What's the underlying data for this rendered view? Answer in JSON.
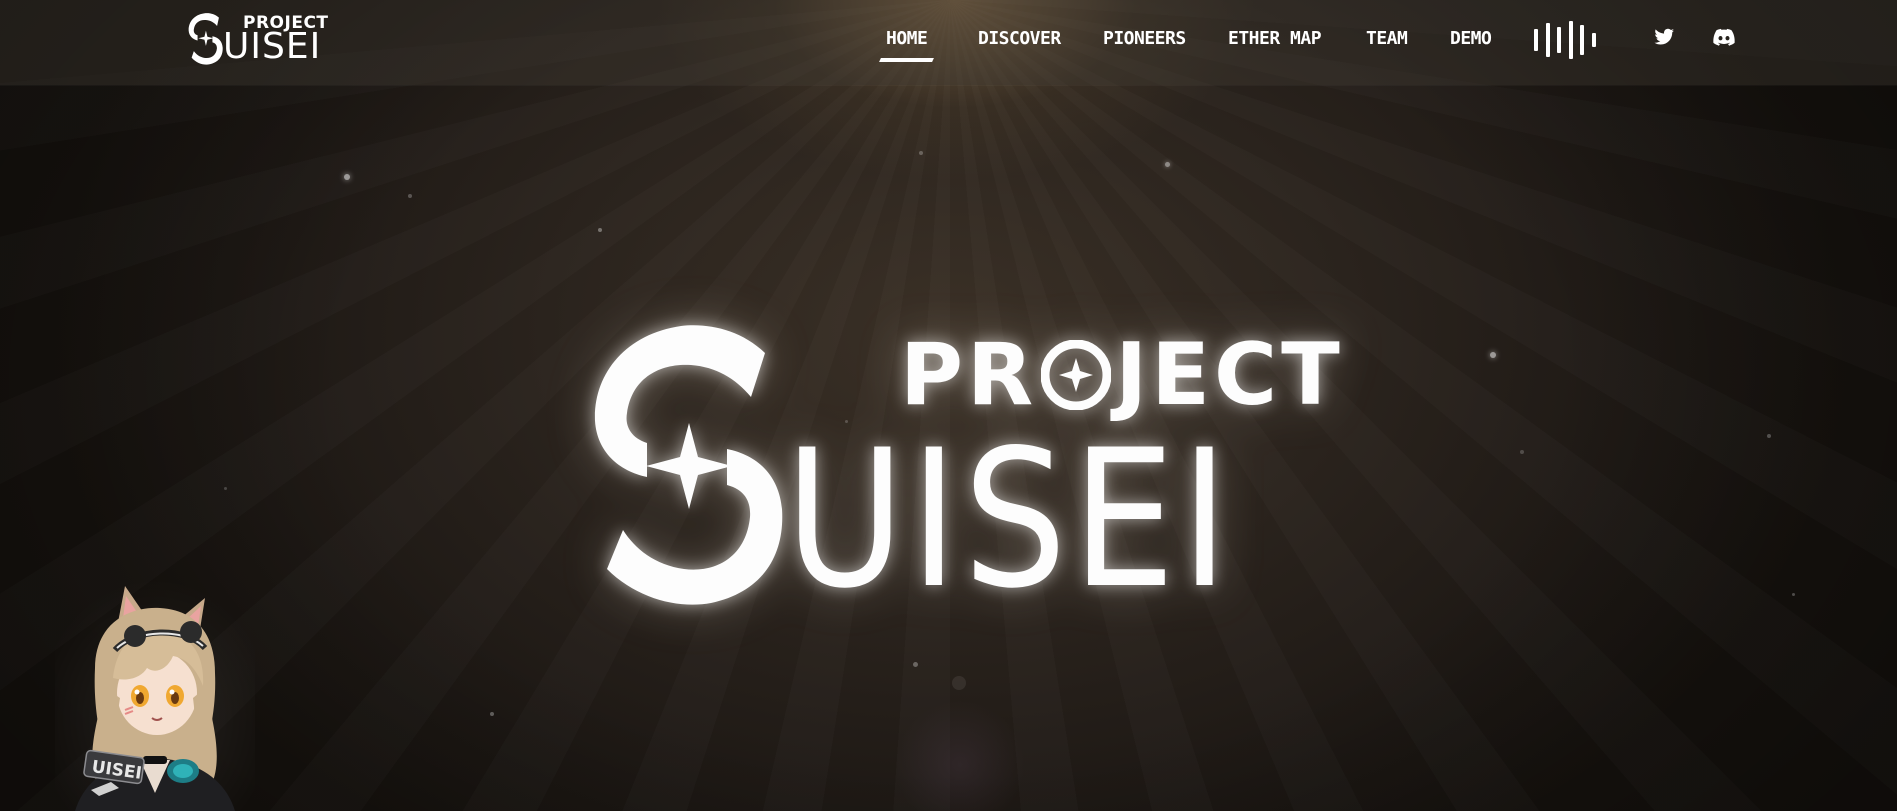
{
  "brand": {
    "logo_project": "PROJECT",
    "logo_name": "UISEI"
  },
  "nav": {
    "items": [
      {
        "label": "HOME",
        "active": true
      },
      {
        "label": "DISCOVER",
        "active": false
      },
      {
        "label": "PIONEERS",
        "active": false
      },
      {
        "label": "ETHER MAP",
        "active": false
      },
      {
        "label": "TEAM",
        "active": false
      },
      {
        "label": "DEMO",
        "active": false
      }
    ],
    "audio_icon": "equalizer-icon",
    "social": [
      {
        "name": "twitter-icon"
      },
      {
        "name": "discord-icon"
      }
    ]
  },
  "hero": {
    "logo_project": "PR  JECT",
    "logo_name": "UISEI"
  },
  "mascot": {
    "badge_text": "UISEI"
  },
  "colors": {
    "accent": "#ffffff",
    "background": "#1c1713",
    "glow": "#fff5e1"
  }
}
